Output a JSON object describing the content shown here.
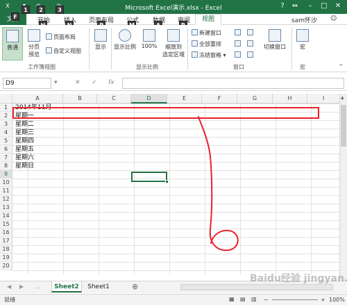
{
  "window": {
    "title": "Microsoft Excel演示.xlsx - Excel",
    "help": "?",
    "minimize": "–",
    "maximize": "□",
    "close": "✕",
    "restore_ribbon": "⇔"
  },
  "qat": {
    "save": "▮",
    "undo": "↶",
    "redo": "↷",
    "keytips": [
      "1",
      "2",
      "3"
    ]
  },
  "tabs": {
    "file": "文件",
    "file_keytip": "F",
    "items": [
      {
        "label": "开始",
        "keytip": "H"
      },
      {
        "label": "插入",
        "keytip": "N"
      },
      {
        "label": "页面布局",
        "keytip": "P"
      },
      {
        "label": "公式",
        "keytip": "M"
      },
      {
        "label": "数据",
        "keytip": "A"
      },
      {
        "label": "审阅",
        "keytip": "R"
      }
    ],
    "active": "视图",
    "user": "sam怀沙"
  },
  "ribbon": {
    "normal": "普通",
    "page_break": "分页\n预览",
    "page_layout": "页面布局",
    "custom_views": "自定义视图",
    "group_workbook_views": "工作簿视图",
    "show": "显示",
    "zoom": "显示比例",
    "zoom_100": "100%",
    "zoom_selection": "缩放到\n选定区域",
    "group_zoom": "显示比例",
    "new_window": "新建窗口",
    "arrange_all": "全部重排",
    "freeze_panes": "冻结窗格",
    "switch_windows": "切换窗口",
    "group_window": "窗口",
    "macros": "宏",
    "group_macros": "宏"
  },
  "formula_bar": {
    "name_box": "D9",
    "cancel": "✕",
    "enter": "✓",
    "fx": "fx",
    "value": ""
  },
  "sheet": {
    "columns": [
      "A",
      "B",
      "C",
      "D",
      "E",
      "F",
      "G",
      "H",
      "I"
    ],
    "rows": [
      "1",
      "2",
      "3",
      "4",
      "5",
      "6",
      "7",
      "8",
      "9",
      "10",
      "11",
      "12",
      "13",
      "14",
      "15",
      "16",
      "17",
      "18",
      "19",
      "20"
    ],
    "active_column": "D",
    "active_row": "9",
    "cells": {
      "A1": "2014年11月",
      "A2": "星期一",
      "A3": "星期二",
      "A4": "星期三",
      "A5": "星期四",
      "A6": "星期五",
      "A7": "星期六",
      "A8": "星期日"
    }
  },
  "sheet_tabs": {
    "tabs": [
      "Sheet2",
      "Sheet1"
    ],
    "active": "Sheet2",
    "add": "⊕"
  },
  "status": {
    "ready": "就绪",
    "zoom": "100%"
  },
  "watermark": "Baidu经验 jingyan.baidu.com",
  "colors": {
    "accent": "#217346",
    "annotation": "#e8202a"
  }
}
